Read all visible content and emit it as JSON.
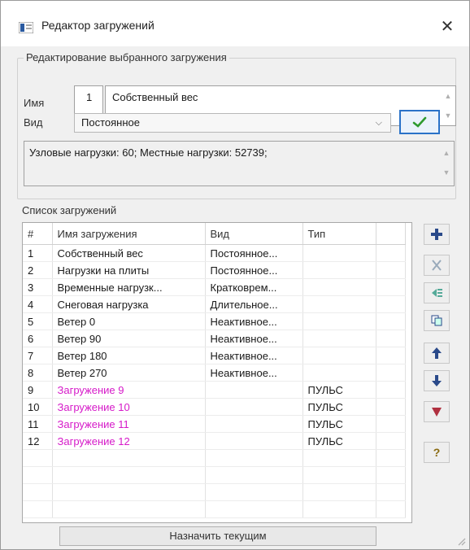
{
  "window": {
    "title": "Редактор загружений",
    "close_glyph": "✕"
  },
  "edit_group": {
    "legend": "Редактирование выбранного загружения",
    "name_label": "Имя",
    "number": "1",
    "name_value": "Собственный вес",
    "type_label": "Вид",
    "type_value": "Постоянное",
    "info": "Узловые нагрузки: 60; Местные нагрузки: 52739;"
  },
  "list": {
    "title": "Список загружений",
    "columns": [
      "#",
      "Имя загружения",
      "Вид",
      "Тип"
    ],
    "rows": [
      {
        "n": "1",
        "name": "Собственный вес",
        "kind": "Постоянное...",
        "type": ""
      },
      {
        "n": "2",
        "name": "Нагрузки на плиты",
        "kind": "Постоянное...",
        "type": ""
      },
      {
        "n": "3",
        "name": "Временные нагрузк...",
        "kind": "Кратковрем...",
        "type": ""
      },
      {
        "n": "4",
        "name": "Снеговая нагрузка",
        "kind": "Длительное...",
        "type": ""
      },
      {
        "n": "5",
        "name": "Ветер 0",
        "kind": "Неактивное...",
        "type": ""
      },
      {
        "n": "6",
        "name": "Ветер 90",
        "kind": "Неактивное...",
        "type": ""
      },
      {
        "n": "7",
        "name": "Ветер 180",
        "kind": "Неактивное...",
        "type": ""
      },
      {
        "n": "8",
        "name": "Ветер 270",
        "kind": "Неактивное...",
        "type": ""
      },
      {
        "n": "9",
        "name": "Загружение 9",
        "kind": "",
        "type": "ПУЛЬС",
        "highlight": true
      },
      {
        "n": "10",
        "name": "Загружение 10",
        "kind": "",
        "type": "ПУЛЬС",
        "highlight": true
      },
      {
        "n": "11",
        "name": "Загружение 11",
        "kind": "",
        "type": "ПУЛЬС",
        "highlight": true
      },
      {
        "n": "12",
        "name": "Загружение 12",
        "kind": "",
        "type": "ПУЛЬС",
        "highlight": true
      }
    ],
    "assign_button": "Назначить текущим"
  },
  "side_buttons": [
    "add-icon",
    "delete-icon",
    "insert-icon",
    "copy-icon",
    "move-up-icon",
    "move-down-icon",
    "remove-heart-icon",
    "help-icon"
  ],
  "colors": {
    "accent": "#2a72c8",
    "highlight_text": "#d61ac9",
    "apply_check": "#2e9a2e"
  },
  "help_glyph": "?"
}
